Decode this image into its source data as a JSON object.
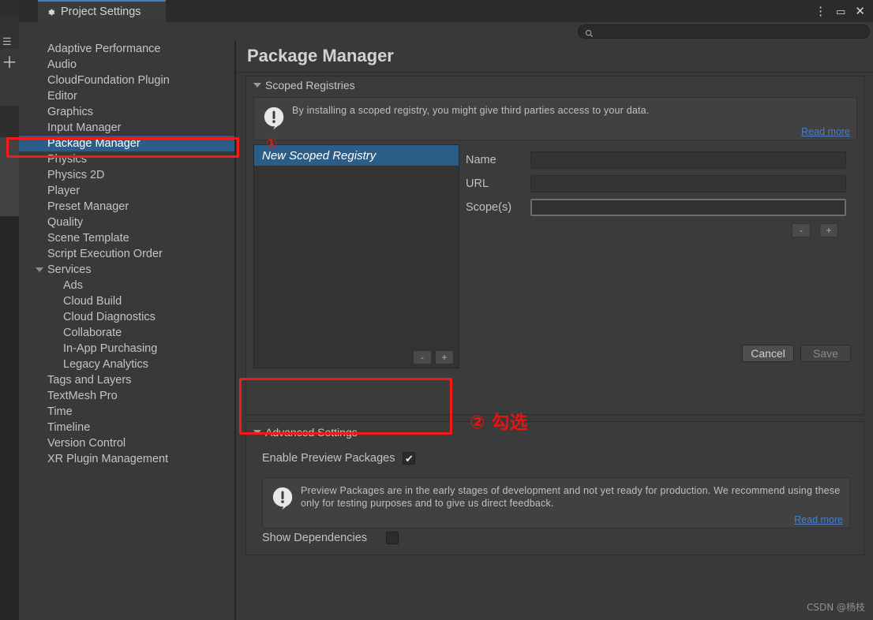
{
  "window": {
    "tab_title": "Project Settings",
    "tab_icon": "gear-icon",
    "controls": {
      "kebab": "⋮",
      "maximize": "▭",
      "close": "✕"
    }
  },
  "search": {
    "value": "",
    "placeholder": "",
    "icon": "search-icon"
  },
  "sidebar": {
    "items": [
      {
        "label": "Adaptive Performance",
        "indent": 0,
        "foldout": false,
        "selected": false
      },
      {
        "label": "Audio",
        "indent": 0,
        "foldout": false,
        "selected": false
      },
      {
        "label": "CloudFoundation Plugin",
        "indent": 0,
        "foldout": false,
        "selected": false
      },
      {
        "label": "Editor",
        "indent": 0,
        "foldout": false,
        "selected": false
      },
      {
        "label": "Graphics",
        "indent": 0,
        "foldout": false,
        "selected": false
      },
      {
        "label": "Input Manager",
        "indent": 0,
        "foldout": false,
        "selected": false
      },
      {
        "label": "Package Manager",
        "indent": 0,
        "foldout": false,
        "selected": true
      },
      {
        "label": "Physics",
        "indent": 0,
        "foldout": false,
        "selected": false
      },
      {
        "label": "Physics 2D",
        "indent": 0,
        "foldout": false,
        "selected": false
      },
      {
        "label": "Player",
        "indent": 0,
        "foldout": false,
        "selected": false
      },
      {
        "label": "Preset Manager",
        "indent": 0,
        "foldout": false,
        "selected": false
      },
      {
        "label": "Quality",
        "indent": 0,
        "foldout": false,
        "selected": false
      },
      {
        "label": "Scene Template",
        "indent": 0,
        "foldout": false,
        "selected": false
      },
      {
        "label": "Script Execution Order",
        "indent": 0,
        "foldout": false,
        "selected": false
      },
      {
        "label": "Services",
        "indent": 0,
        "foldout": true,
        "selected": false
      },
      {
        "label": "Ads",
        "indent": 1,
        "foldout": false,
        "selected": false
      },
      {
        "label": "Cloud Build",
        "indent": 1,
        "foldout": false,
        "selected": false
      },
      {
        "label": "Cloud Diagnostics",
        "indent": 1,
        "foldout": false,
        "selected": false
      },
      {
        "label": "Collaborate",
        "indent": 1,
        "foldout": false,
        "selected": false
      },
      {
        "label": "In-App Purchasing",
        "indent": 1,
        "foldout": false,
        "selected": false
      },
      {
        "label": "Legacy Analytics",
        "indent": 1,
        "foldout": false,
        "selected": false
      },
      {
        "label": "Tags and Layers",
        "indent": 0,
        "foldout": false,
        "selected": false
      },
      {
        "label": "TextMesh Pro",
        "indent": 0,
        "foldout": false,
        "selected": false
      },
      {
        "label": "Time",
        "indent": 0,
        "foldout": false,
        "selected": false
      },
      {
        "label": "Timeline",
        "indent": 0,
        "foldout": false,
        "selected": false
      },
      {
        "label": "Version Control",
        "indent": 0,
        "foldout": false,
        "selected": false
      },
      {
        "label": "XR Plugin Management",
        "indent": 0,
        "foldout": false,
        "selected": false
      }
    ]
  },
  "main": {
    "page_title": "Package Manager",
    "scoped_registries": {
      "section_label": "Scoped Registries",
      "help_text": "By installing a scoped registry, you might give third parties access to your data.",
      "read_more": "Read more",
      "registry_list": [
        {
          "name": "New Scoped Registry",
          "selected": true
        }
      ],
      "list_remove_label": "-",
      "list_add_label": "+",
      "form": {
        "name_label": "Name",
        "name_value": "",
        "url_label": "URL",
        "url_value": "",
        "scopes_label": "Scope(s)",
        "scopes_value": "",
        "scope_remove_label": "-",
        "scope_add_label": "+"
      },
      "cancel_label": "Cancel",
      "save_label": "Save"
    },
    "advanced_settings": {
      "section_label": "Advanced Settings",
      "enable_preview_label": "Enable Preview Packages",
      "enable_preview_checked": true,
      "preview_help_text": "Preview Packages are in the early stages of development and not yet ready for production. We recommend using these only for testing purposes and to give us direct feedback.",
      "preview_read_more": "Read more",
      "show_dependencies_label": "Show Dependencies",
      "show_dependencies_checked": false
    }
  },
  "annotations": {
    "step_one": "①",
    "step_two": "② 勾选",
    "accent_color": "#f51a1a"
  },
  "watermark": "CSDN @杨枝"
}
